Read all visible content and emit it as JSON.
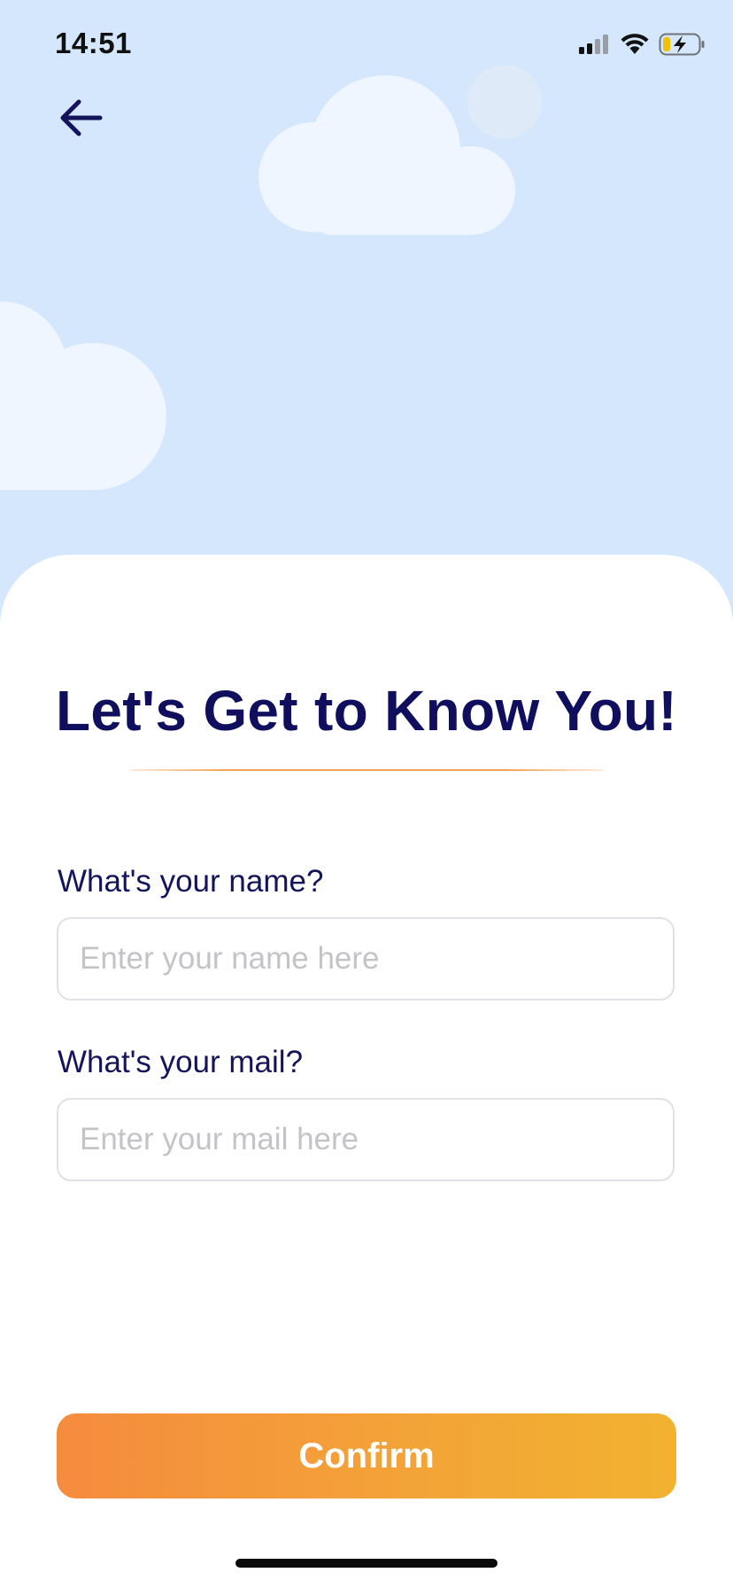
{
  "status_bar": {
    "time": "14:51"
  },
  "header": {
    "back_icon": "arrow-left-icon"
  },
  "main": {
    "title": "Let's Get to Know You!",
    "name_field": {
      "label": "What's your name?",
      "placeholder": "Enter your name here",
      "value": ""
    },
    "mail_field": {
      "label": "What's your mail?",
      "placeholder": "Enter your mail here",
      "value": ""
    },
    "confirm_label": "Confirm"
  },
  "colors": {
    "sky": "#d5e7fd",
    "title": "#0f0f5e",
    "accent_start": "#f58b3e",
    "accent_end": "#f2b22f"
  }
}
